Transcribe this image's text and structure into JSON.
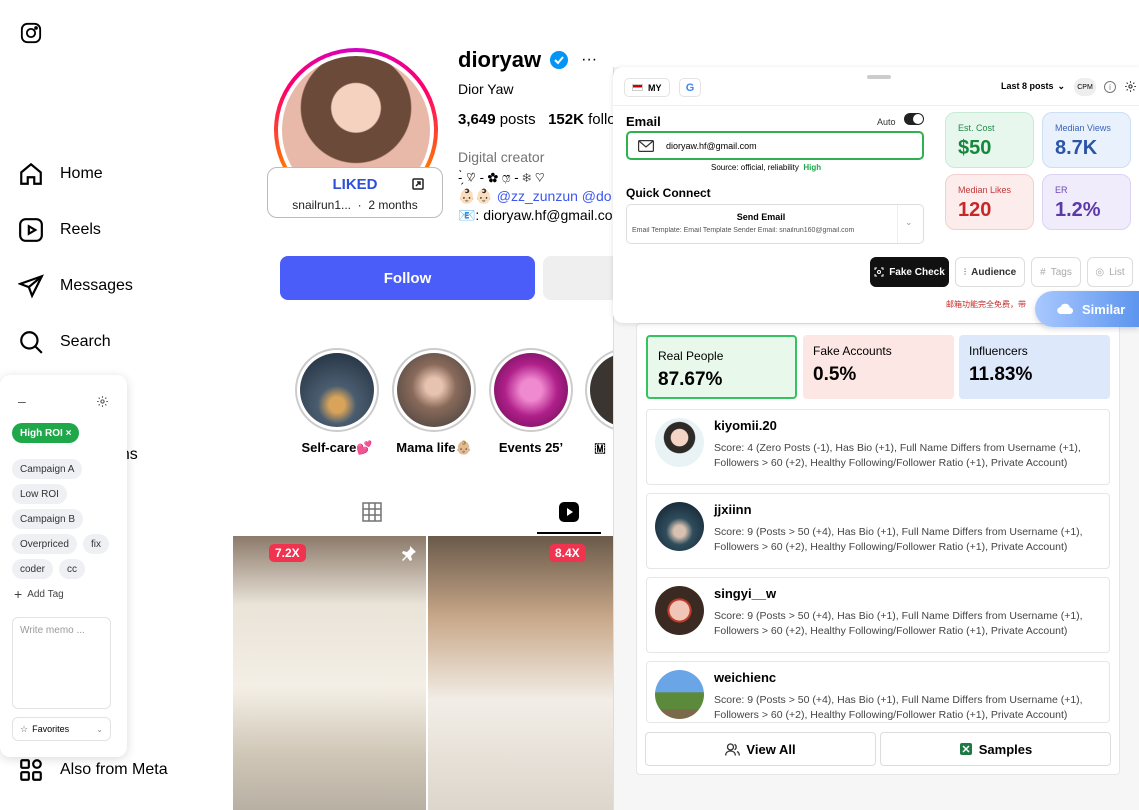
{
  "nav": {
    "home": "Home",
    "reels": "Reels",
    "messages": "Messages",
    "search": "Search",
    "partial": "ons",
    "meta": "Also from Meta"
  },
  "profile": {
    "username": "dioryaw",
    "full_name": "Dior Yaw",
    "posts_count": "3,649",
    "posts_label": "posts",
    "followers_count": "152K",
    "followers_label": "follo",
    "category": "Digital creator",
    "bio_line1": "-̗̀ ♡̷ - ✿ ෆ̷ - ❄ ♡",
    "bio_line2_prefix": "👶🏻👶🏻",
    "bio_line2_link": "@zz_zunzun @do",
    "bio_line3": "📧: dioryaw.hf@gmail.co",
    "follow_label": "Follow"
  },
  "liked_card": {
    "title": "LIKED",
    "user": "snailrun1...",
    "sep": "·",
    "time": "2 months"
  },
  "stories": [
    {
      "label": "Self-care💕"
    },
    {
      "label": "Mama life👶🏼"
    },
    {
      "label": "Events 25’"
    },
    {
      "label": "🇲"
    }
  ],
  "posts": [
    {
      "badge": "7.2X"
    },
    {
      "badge": "8.4X"
    }
  ],
  "memo": {
    "minimize": "–",
    "active_tag": "High ROI",
    "tags": [
      "Campaign A",
      "Low ROI",
      "Campaign B",
      "Overpriced",
      "fix",
      "coder",
      "cc"
    ],
    "add_tag": "Add Tag",
    "placeholder": "Write memo ...",
    "favorites": "Favorites"
  },
  "ext": {
    "region": "MY",
    "range": "Last 8 posts",
    "cpm": "CPM",
    "email_title": "Email",
    "auto": "Auto",
    "email_value": "dioryaw.hf@gmail.com",
    "source_text": "Source: official, reliability",
    "reliability": "High",
    "quick_connect": "Quick Connect",
    "send_email": "Send Email",
    "template_line": "Email Template:  Email Template   Sender Email:  snailrun160@gmail.com",
    "stats": {
      "est_cost_label": "Est. Cost",
      "est_cost": "$50",
      "median_views_label": "Median Views",
      "median_views": "8.7K",
      "median_likes_label": "Median Likes",
      "median_likes": "120",
      "er_label": "ER",
      "er": "1.2%"
    },
    "buttons": {
      "fake_check": "Fake Check",
      "audience": "Audience",
      "tags": "Tags",
      "list": "List",
      "similar": "Similar"
    },
    "notice": "邮箱功能完全免费，带",
    "results": {
      "real_label": "Real People",
      "real": "87.67%",
      "fake_label": "Fake Accounts",
      "fake": "0.5%",
      "influencers_label": "Influencers",
      "influencers": "11.83%"
    },
    "users": [
      {
        "name": "kiyomii.20",
        "score": "Score: 4 (Zero Posts (-1), Has Bio (+1), Full Name Differs from Username (+1), Followers > 60 (+2), Healthy Following/Follower Ratio (+1), Private Account)"
      },
      {
        "name": "jjxiinn",
        "score": "Score: 9 (Posts > 50 (+4), Has Bio (+1), Full Name Differs from Username (+1), Followers > 60 (+2), Healthy Following/Follower Ratio (+1), Private Account)"
      },
      {
        "name": "singyi__w",
        "score": "Score: 9 (Posts > 50 (+4), Has Bio (+1), Full Name Differs from Username (+1), Followers > 60 (+2), Healthy Following/Follower Ratio (+1), Private Account)"
      },
      {
        "name": "weichienc",
        "score": "Score: 9 (Posts > 50 (+4), Has Bio (+1), Full Name Differs from Username (+1), Followers > 60 (+2), Healthy Following/Follower Ratio (+1), Private Account)"
      }
    ],
    "view_all": "View All",
    "samples": "Samples"
  }
}
